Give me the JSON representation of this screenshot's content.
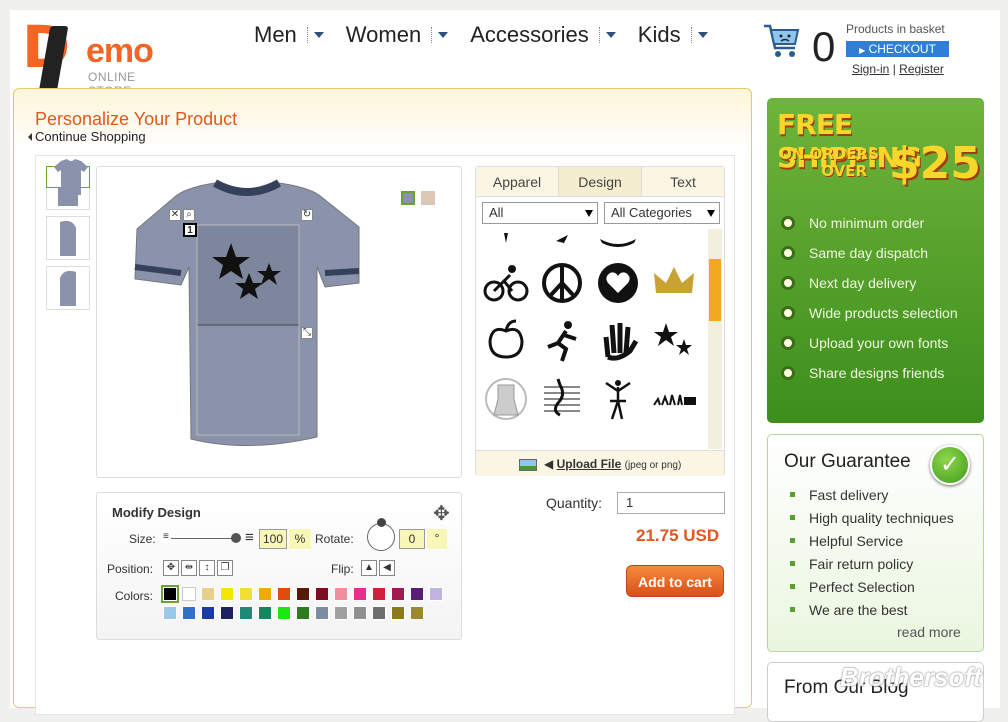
{
  "brand": {
    "name": "emo",
    "initial": "D",
    "tagline": "ONLINE STORE"
  },
  "nav": {
    "items": [
      "Men",
      "Women",
      "Accessories",
      "Kids"
    ]
  },
  "cart": {
    "count": "0",
    "label": "Products in basket",
    "checkout": "CHECKOUT",
    "signin": "Sign-in",
    "sep": "|",
    "register": "Register"
  },
  "main": {
    "title": "Personalize Your Product",
    "continue": "Continue Shopping"
  },
  "designer": {
    "tabs": [
      "Apparel",
      "Design",
      "Text"
    ],
    "filter1": "All",
    "filter2": "All Categories",
    "upload_label": "Upload File",
    "upload_hint": "(jpeg or png)",
    "layer_number": "1",
    "shirt_color": "#8a93ab",
    "alt_color": "#d9c8b4"
  },
  "modify": {
    "title": "Modify Design",
    "size_label": "Size:",
    "size_value": "100",
    "percent": "%",
    "rotate_label": "Rotate:",
    "rotate_value": "0",
    "degree": "°",
    "position_label": "Position:",
    "flip_label": "Flip:",
    "colors_label": "Colors:",
    "colors": [
      "#000000",
      "#ffffff",
      "#e8d08a",
      "#f3e600",
      "#f0e030",
      "#f5a800",
      "#e24b10",
      "#5a1a0a",
      "#7a0f22",
      "#f08e9a",
      "#e8308a",
      "#d0203e",
      "#a01c4e",
      "#5a1e78",
      "#c2b2de",
      "#9ac8e6",
      "#2d72c8",
      "#1a3aa8",
      "#1e1f5e",
      "#1e8a76",
      "#108a5c",
      "#19e811",
      "#2e7a1e",
      "#7a8ea0",
      "#a0a0a0",
      "#909090",
      "#6e6e6e",
      "#8a7a1a",
      "#9a8a2a"
    ]
  },
  "purchase": {
    "qty_label": "Quantity:",
    "qty": "1",
    "price": "21.75 USD",
    "add": "Add to cart"
  },
  "shipping": {
    "title": "FREE SHIPPING",
    "line1": "ON ORDERS",
    "line2": "OVER",
    "amount": "$25",
    "items": [
      "No minimum order",
      "Same day dispatch",
      "Next day delivery",
      "Wide products selection",
      "Upload your own fonts",
      "Share designs friends"
    ]
  },
  "guarantee": {
    "title": "Our Guarantee",
    "items": [
      "Fast delivery",
      "High quality techniques",
      "Helpful Service",
      "Fair return policy",
      "Perfect Selection",
      "We are the best"
    ],
    "more": "read more"
  },
  "blog": {
    "title": "From Our Blog"
  },
  "watermark": "Brothersoft"
}
